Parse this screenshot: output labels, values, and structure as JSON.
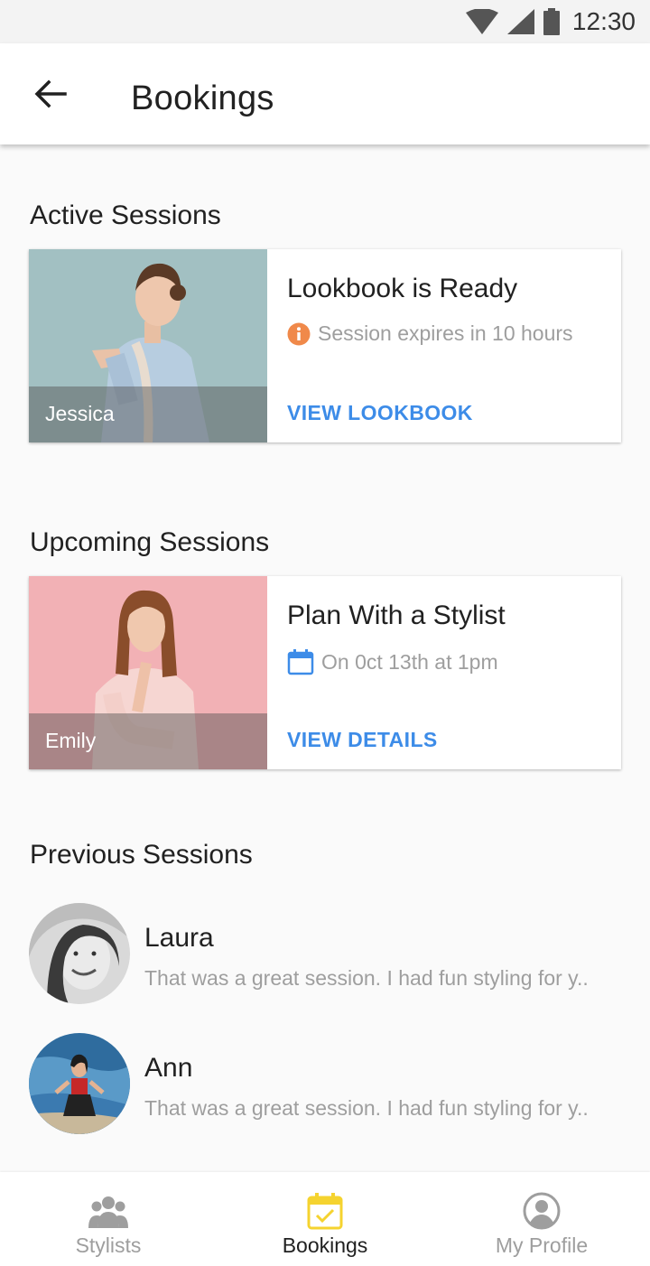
{
  "status_bar": {
    "time": "12:30"
  },
  "app_bar": {
    "title": "Bookings"
  },
  "sections": {
    "active": "Active Sessions",
    "upcoming": "Upcoming Sessions",
    "previous": "Previous Sessions"
  },
  "active_card": {
    "stylist": "Jessica",
    "title": "Lookbook is Ready",
    "meta": "Session expires in 10 hours",
    "action": "VIEW LOOKBOOK"
  },
  "upcoming_card": {
    "stylist": "Emily",
    "title": "Plan With a Stylist",
    "meta": "On 0ct 13th at 1pm",
    "action": "VIEW DETAILS"
  },
  "previous_sessions": [
    {
      "name": "Laura",
      "message": "That was a great session. I had fun styling for y.."
    },
    {
      "name": "Ann",
      "message": "That was a great session. I had fun styling for y.."
    }
  ],
  "bottom_nav": {
    "items": [
      {
        "label": "Stylists",
        "icon": "group-icon"
      },
      {
        "label": "Bookings",
        "icon": "calendar-check-icon"
      },
      {
        "label": "My Profile",
        "icon": "account-circle-icon"
      }
    ],
    "active_index": 1
  },
  "colors": {
    "accent": "#3d8ce8",
    "warning": "#f0894a",
    "active_nav": "#f5d32f"
  }
}
